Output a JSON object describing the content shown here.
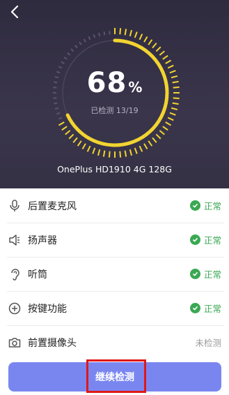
{
  "header": {
    "back_icon": "chevron-left-icon",
    "progress": {
      "percent": "68",
      "percent_symbol": "%",
      "detected_text": "已检测 13/19",
      "fraction": 0.68
    },
    "device_name": "OnePlus HD1910 4G 128G"
  },
  "items": [
    {
      "label": "后置麦克风",
      "icon": "microphone-icon",
      "status": "正常",
      "state": "ok"
    },
    {
      "label": "扬声器",
      "icon": "speaker-icon",
      "status": "正常",
      "state": "ok"
    },
    {
      "label": "听筒",
      "icon": "earpiece-icon",
      "status": "正常",
      "state": "ok"
    },
    {
      "label": "按键功能",
      "icon": "button-function-icon",
      "status": "正常",
      "state": "ok"
    },
    {
      "label": "前置摄像头",
      "icon": "camera-icon",
      "status": "未检测",
      "state": "pending"
    }
  ],
  "footer": {
    "continue_label": "继续检测"
  },
  "colors": {
    "accent": "#f2d431",
    "ok": "#3aa853",
    "button": "#7a86f0",
    "highlight": "#e01818"
  }
}
